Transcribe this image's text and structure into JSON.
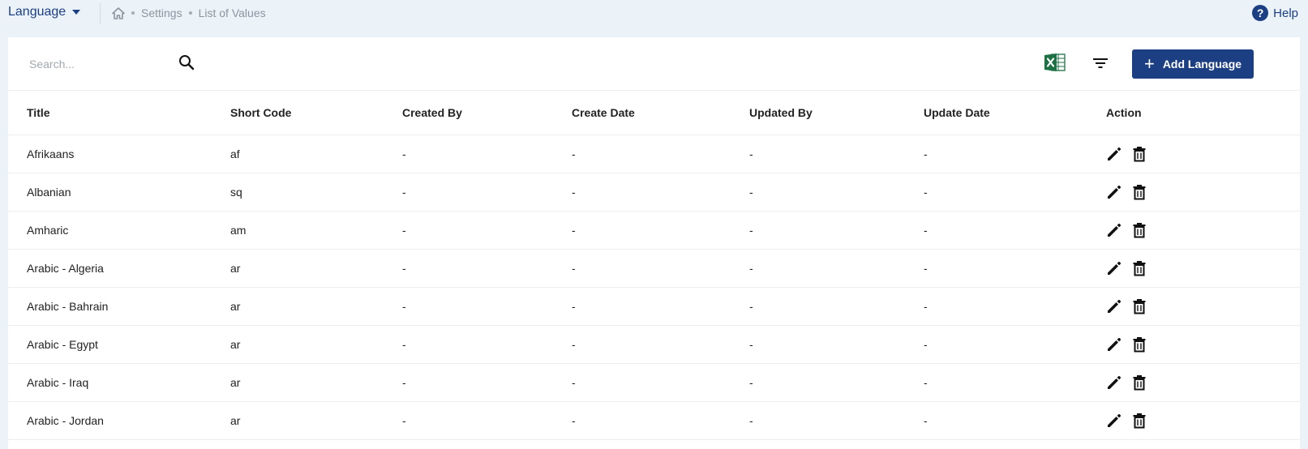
{
  "topbar": {
    "language_label": "Language",
    "breadcrumb": [
      "Settings",
      "List of Values"
    ],
    "help_label": "Help"
  },
  "toolbar": {
    "search_placeholder": "Search...",
    "add_button_label": "Add Language"
  },
  "icons": {
    "home": "home-icon",
    "search": "search-icon",
    "excel": "excel-export-icon",
    "filter": "filter-icon",
    "edit": "pencil-icon",
    "delete": "trash-icon",
    "help": "question-circle-icon",
    "dropdown": "caret-down-icon"
  },
  "colors": {
    "brand": "#1c3f84",
    "page_background": "#ebf2f8",
    "excel_green": "#1e7145"
  },
  "table": {
    "headers": [
      "Title",
      "Short Code",
      "Created By",
      "Create Date",
      "Updated By",
      "Update Date",
      "Action"
    ],
    "rows": [
      [
        "Afrikaans",
        "af",
        "-",
        "-",
        "-",
        "-"
      ],
      [
        "Albanian",
        "sq",
        "-",
        "-",
        "-",
        "-"
      ],
      [
        "Amharic",
        "am",
        "-",
        "-",
        "-",
        "-"
      ],
      [
        "Arabic - Algeria",
        "ar",
        "-",
        "-",
        "-",
        "-"
      ],
      [
        "Arabic - Bahrain",
        "ar",
        "-",
        "-",
        "-",
        "-"
      ],
      [
        "Arabic - Egypt",
        "ar",
        "-",
        "-",
        "-",
        "-"
      ],
      [
        "Arabic - Iraq",
        "ar",
        "-",
        "-",
        "-",
        "-"
      ],
      [
        "Arabic - Jordan",
        "ar",
        "-",
        "-",
        "-",
        "-"
      ]
    ]
  }
}
